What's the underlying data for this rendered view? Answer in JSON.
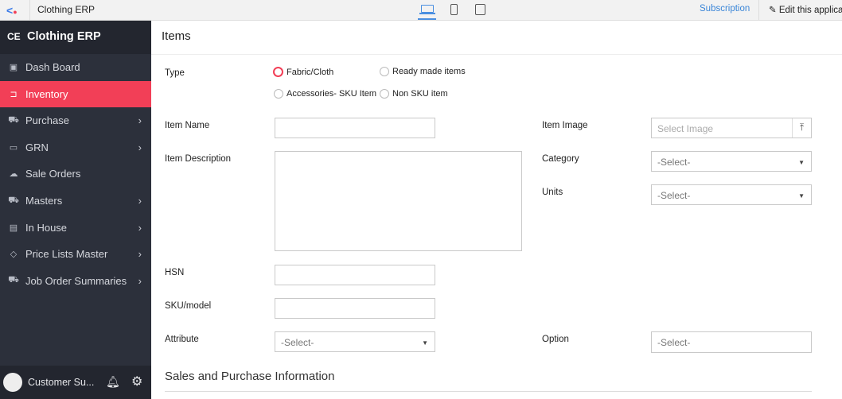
{
  "topbar": {
    "app_name": "Clothing ERP",
    "subscription": "Subscription",
    "edit": "Edit this application"
  },
  "sidebar": {
    "logo": "CE",
    "title": "Clothing ERP",
    "items": [
      {
        "label": "Dash Board",
        "icon": "dashboard-icon",
        "chevron": false
      },
      {
        "label": "Inventory",
        "icon": "inventory-icon",
        "chevron": false,
        "active": true
      },
      {
        "label": "Purchase",
        "icon": "purchase-icon",
        "chevron": true
      },
      {
        "label": "GRN",
        "icon": "monitor-icon",
        "chevron": true
      },
      {
        "label": "Sale Orders",
        "icon": "cloud-icon",
        "chevron": false
      },
      {
        "label": "Masters",
        "icon": "masters-icon",
        "chevron": true
      },
      {
        "label": "In House",
        "icon": "house-icon",
        "chevron": true
      },
      {
        "label": "Price Lists Master",
        "icon": "tag-icon",
        "chevron": true
      },
      {
        "label": "Job Order Summaries",
        "icon": "cart-icon",
        "chevron": true
      }
    ],
    "user": "Customer Su..."
  },
  "form": {
    "title": "Items",
    "type_label": "Type",
    "type_options": [
      "Fabric/Cloth",
      "Ready made items",
      "Accessories- SKU Item",
      "Non SKU item"
    ],
    "item_name": "Item Name",
    "item_description": "Item Description",
    "hsn": "HSN",
    "sku": "SKU/model",
    "attribute": "Attribute",
    "attribute_value": "-Select-",
    "item_image": "Item Image",
    "item_image_placeholder": "Select Image",
    "category": "Category",
    "category_value": "-Select-",
    "units": "Units",
    "units_value": "-Select-",
    "option": "Option",
    "option_value": "-Select-",
    "section2": "Sales and Purchase Information"
  }
}
